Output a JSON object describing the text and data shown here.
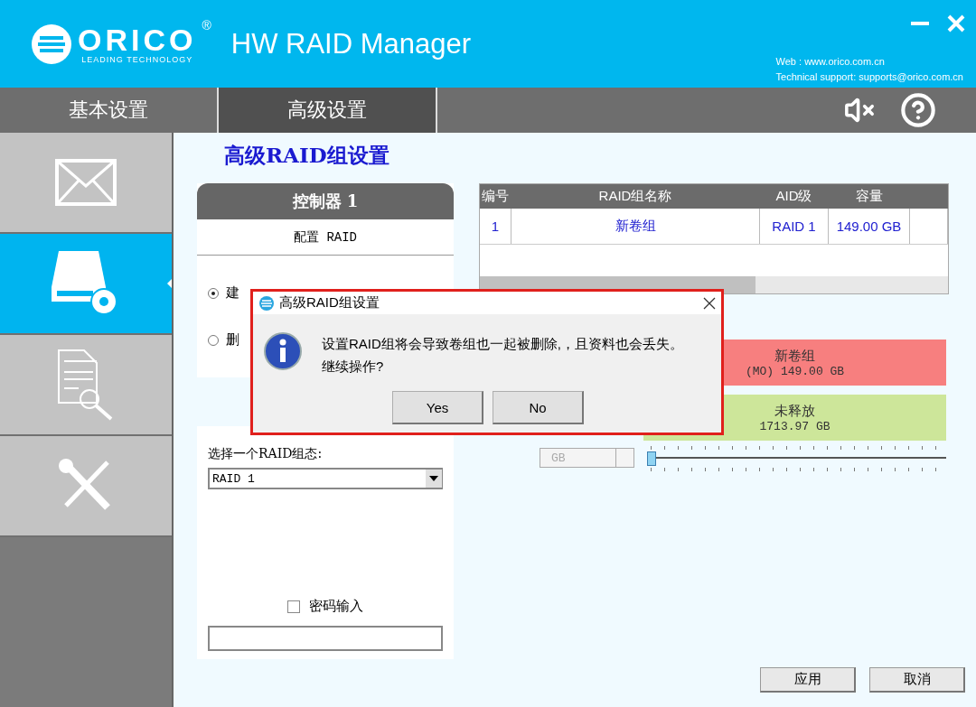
{
  "window": {
    "logo": {
      "brand": "ORICO",
      "registered": "®",
      "tagline": "LEADING TECHNOLOGY"
    },
    "title": "HW RAID Manager",
    "web": "Web : www.orico.com.cn",
    "support": "Technical support: supports@orico.com.cn"
  },
  "tabs": [
    {
      "label": "基本设置",
      "selected": false
    },
    {
      "label": "高级设置",
      "selected": true
    }
  ],
  "sidebar": {
    "items": [
      {
        "kind": "mail",
        "selected": false
      },
      {
        "kind": "drive",
        "selected": true
      },
      {
        "kind": "report",
        "selected": false
      },
      {
        "kind": "tools",
        "selected": false
      }
    ]
  },
  "page_title": "高级RAID组设置",
  "controller": {
    "title": "控制器 1",
    "subtitle": "配置 RAID",
    "options": [
      {
        "label": "建",
        "selected": true
      },
      {
        "label": "删",
        "selected": false
      }
    ],
    "raid_type": {
      "label": "选择一个RAID组态:",
      "value": "RAID 1"
    },
    "password": {
      "label": "密码输入",
      "checked": false
    }
  },
  "table": {
    "columns": [
      "编号",
      "RAID组名称",
      "AID级",
      "容量"
    ],
    "rows": [
      {
        "cells": [
          "1",
          "新卷组",
          "RAID 1",
          "149.00 GB"
        ]
      }
    ]
  },
  "volumes": [
    {
      "name": "新卷组",
      "detail": "(MO) 149.00 GB",
      "color": "#f77f7f"
    },
    {
      "name": "未释放",
      "detail": "1713.97 GB",
      "color": "#cde69a"
    }
  ],
  "size": {
    "unit": "GB",
    "level": 0
  },
  "buttons": [
    "应用",
    "取消"
  ],
  "dialog": {
    "title": "高级RAID组设置",
    "message": "设置RAID组将会导致卷组也一起被删除,，且资料也会丢失。",
    "question": "继续操作?",
    "buttons": [
      "Yes",
      "No"
    ]
  }
}
